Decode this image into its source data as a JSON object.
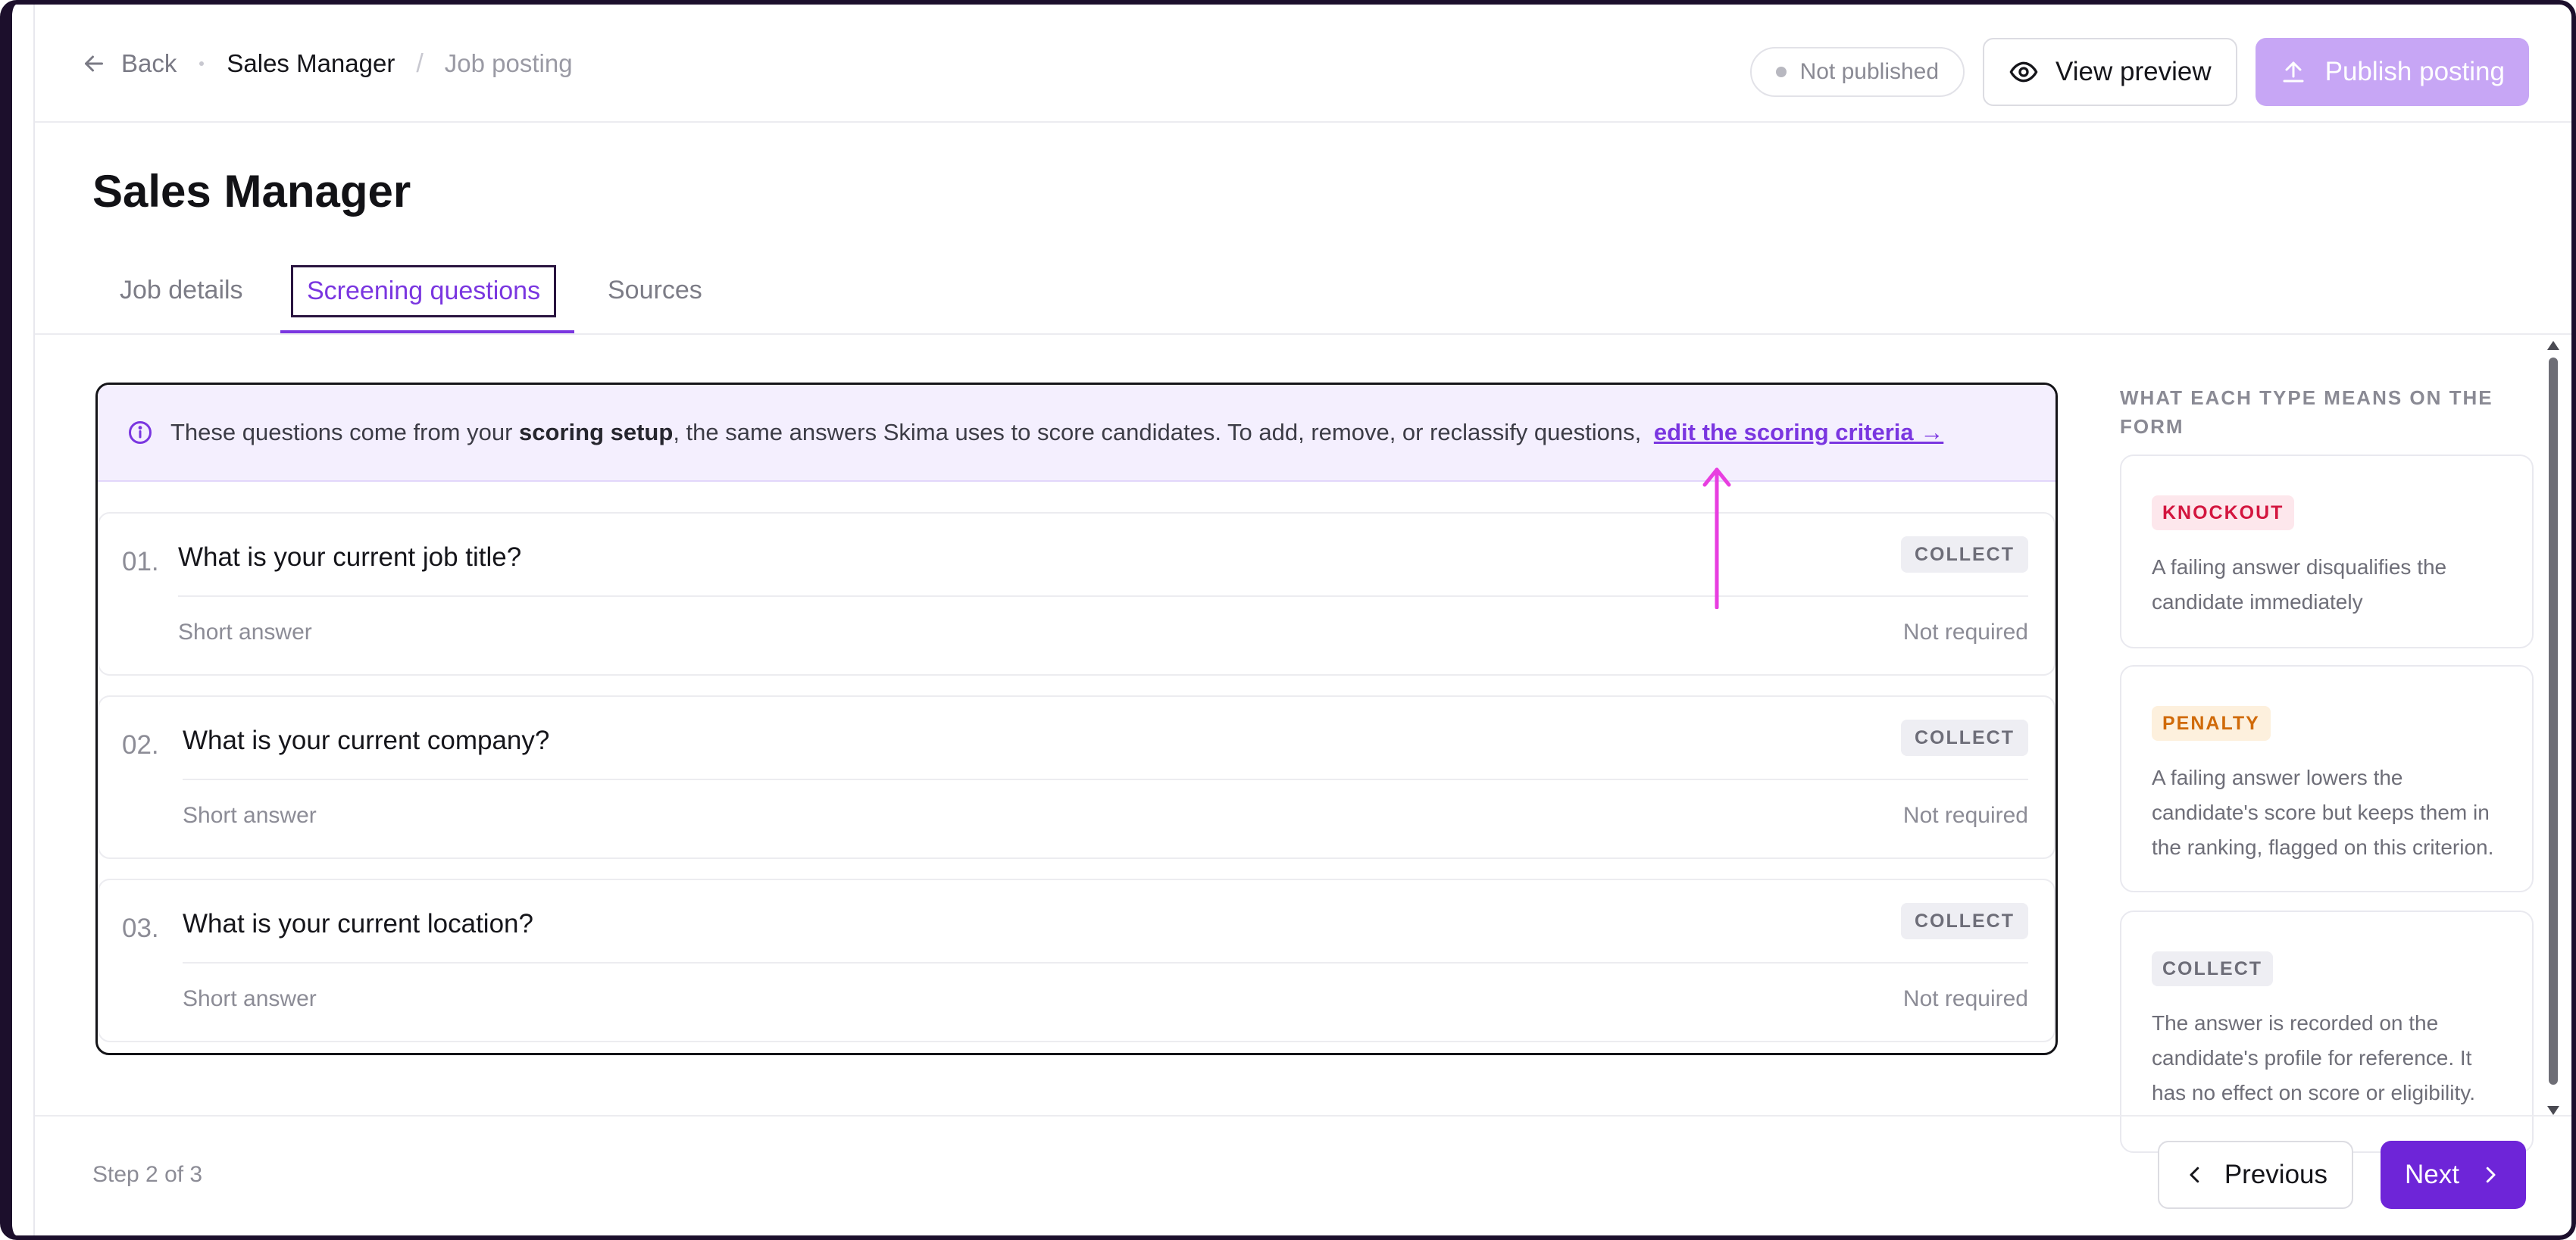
{
  "header": {
    "back_label": "Back",
    "breadcrumb_current": "Sales Manager",
    "breadcrumb_section": "Job posting",
    "status_label": "Not published",
    "view_preview_label": "View preview",
    "publish_label": "Publish posting"
  },
  "page_title": "Sales Manager",
  "tabs": [
    {
      "label": "Job details",
      "active": false
    },
    {
      "label": "Screening questions",
      "active": true
    },
    {
      "label": "Sources",
      "active": false
    }
  ],
  "info_banner": {
    "text_before": "These questions come from your ",
    "bold": "scoring setup",
    "text_after": ", the same answers Skima uses to score candidates. To add, remove, or reclassify questions, ",
    "link": "edit the scoring criteria →"
  },
  "questions": [
    {
      "number": "01.",
      "text": "What is your current job title?",
      "tag": "COLLECT",
      "type": "Short answer",
      "required": "Not required"
    },
    {
      "number": "02.",
      "text": "What is your current company?",
      "tag": "COLLECT",
      "type": "Short answer",
      "required": "Not required"
    },
    {
      "number": "03.",
      "text": "What is your current location?",
      "tag": "COLLECT",
      "type": "Short answer",
      "required": "Not required"
    }
  ],
  "sidebar": {
    "heading": "WHAT EACH TYPE MEANS ON THE FORM",
    "types": [
      {
        "badge": "KNOCKOUT",
        "description": "A failing answer disqualifies the candidate immediately"
      },
      {
        "badge": "PENALTY",
        "description": "A failing answer lowers the candidate's score but keeps them in the ranking, flagged on this criterion."
      },
      {
        "badge": "COLLECT",
        "description": "The answer is recorded on the candidate's profile for reference. It has no effect on score or eligibility."
      }
    ]
  },
  "footer": {
    "step_label": "Step 2 of 3",
    "previous_label": "Previous",
    "next_label": "Next"
  },
  "colors": {
    "accent": "#6e25d8",
    "accent_light": "#c7a6f5",
    "info_bg": "#f4effe",
    "annotation_arrow": "#e83ee0",
    "knockout": "#d3163f",
    "penalty": "#d06a09"
  },
  "icons": {
    "back": "arrow-left-icon",
    "preview": "eye-icon",
    "publish": "upload-icon",
    "info": "info-circle-icon",
    "previous": "chevron-left-icon",
    "next": "chevron-right-icon"
  }
}
